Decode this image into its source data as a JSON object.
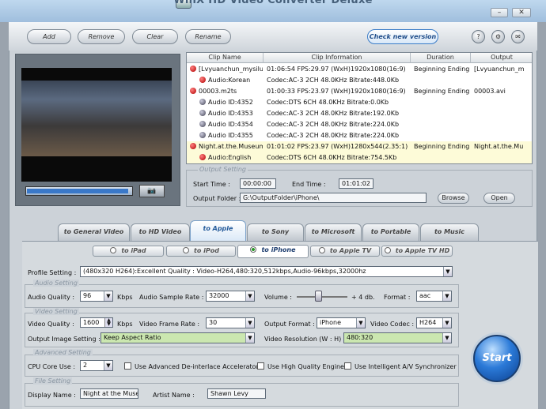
{
  "window": {
    "title": "WinX HD Video Converter Deluxe",
    "min_label": "–",
    "close_label": "✕"
  },
  "toolbar": {
    "add": "Add",
    "remove": "Remove",
    "clear": "Clear",
    "rename": "Rename",
    "check_version": "Check new version",
    "icon_help": "?",
    "icon_settings": "⚙",
    "icon_mail": "✉"
  },
  "player": {
    "progress": 0.0,
    "snapshot_icon": "camera-icon"
  },
  "file_table": {
    "columns": [
      "Clip Name",
      "Clip Information",
      "Duration",
      "Output"
    ],
    "rows": [
      {
        "name": "[Lvyuanchun_mysilu]",
        "info": "01:06:54  FPS:29.97  (WxH)1920x1080(16:9)",
        "duration": "Beginning Ending",
        "output": "[Lvyuanchun_m",
        "highlight": false,
        "indent": 0
      },
      {
        "name": "Audio:Korean",
        "info": "Codec:AC-3 2CH   48.0KHz   Bitrate:448.0Kb",
        "duration": "",
        "output": "",
        "highlight": false,
        "indent": 1
      },
      {
        "name": "00003.m2ts",
        "info": "01:00:33  FPS:23.97  (WxH)1920x1080(16:9)",
        "duration": "Beginning Ending",
        "output": "00003.avi",
        "highlight": false,
        "indent": 0
      },
      {
        "name": "Audio ID:4352",
        "info": "Codec:DTS 6CH   48.0KHz   Bitrate:0.0Kb",
        "duration": "",
        "output": "",
        "highlight": false,
        "indent": 1
      },
      {
        "name": "Audio ID:4353",
        "info": "Codec:AC-3 2CH   48.0KHz   Bitrate:192.0Kb",
        "duration": "",
        "output": "",
        "highlight": false,
        "indent": 1
      },
      {
        "name": "Audio ID:4354",
        "info": "Codec:AC-3 2CH   48.0KHz   Bitrate:224.0Kb",
        "duration": "",
        "output": "",
        "highlight": false,
        "indent": 1
      },
      {
        "name": "Audio ID:4355",
        "info": "Codec:AC-3 2CH   48.0KHz   Bitrate:224.0Kb",
        "duration": "",
        "output": "",
        "highlight": false,
        "indent": 1
      },
      {
        "name": "Night.at.the.Museum",
        "info": "01:01:02  FPS:23.97  (WxH)1280x544(2.35:1)",
        "duration": "Beginning Ending",
        "output": "Night.at.the.Mu",
        "highlight": true,
        "indent": 0
      },
      {
        "name": "Audio:English",
        "info": "Codec:DTS 6CH   48.0KHz   Bitrate:754.5Kb",
        "duration": "",
        "output": "",
        "highlight": true,
        "indent": 1
      }
    ]
  },
  "output_setting": {
    "legend": "Output Setting",
    "start_label": "Start Time :",
    "start_value": "00:00:00",
    "end_label": "End Time :",
    "end_value": "01:01:02",
    "folder_label": "Output Folder :",
    "folder_value": "G:\\OutputFolder\\iPhone\\",
    "browse": "Browse",
    "open": "Open"
  },
  "main_tabs": [
    "to General Video",
    "to HD Video",
    "to Apple",
    "to Sony",
    "to Microsoft",
    "to Portable",
    "to Music"
  ],
  "active_main_tab": 2,
  "sub_tabs": [
    "to iPad",
    "to iPod",
    "to iPhone",
    "to Apple TV",
    "to Apple TV HD"
  ],
  "active_sub_tab": 2,
  "profile": {
    "label": "Profile Setting :",
    "value": "(480x320 H264):Excellent Quality : Video-H264,480:320,512kbps,Audio-96kbps,32000hz"
  },
  "audio": {
    "legend": "Audio Setting",
    "quality_label": "Audio Quality :",
    "quality_value": "96",
    "kbps": "Kbps",
    "rate_label": "Audio Sample Rate :",
    "rate_value": "32000",
    "volume_label": "Volume :",
    "volume_value": "+ 4 db.",
    "format_label": "Format :",
    "format_value": "aac"
  },
  "video": {
    "legend": "Video Setting",
    "quality_label": "Video Quality :",
    "quality_value": "1600",
    "kbps": "Kbps",
    "frame_label": "Video Frame Rate :",
    "frame_value": "30",
    "output_format_label": "Output Format :",
    "output_format_value": "iPhone",
    "codec_label": "Video Codec :",
    "codec_value": "H264",
    "image_label": "Output Image Setting :",
    "image_value": "Keep Aspect Ratio",
    "resolution_label": "Video Resolution (W : H) :",
    "resolution_value": "480:320"
  },
  "advanced": {
    "legend": "Advanced Setting",
    "cpu_label": "CPU Core Use :",
    "cpu_value": "2",
    "deinterlace": "Use Advanced De-interlace Accelerator",
    "high_quality": "Use High Quality Engine",
    "av_sync": "Use Intelligent A/V Synchronizer"
  },
  "file_setting": {
    "legend": "File Setting",
    "display_label": "Display Name :",
    "display_value": "Night at the Museu",
    "artist_label": "Artist Name :",
    "artist_value": "Shawn Levy"
  },
  "start_button": "Start"
}
